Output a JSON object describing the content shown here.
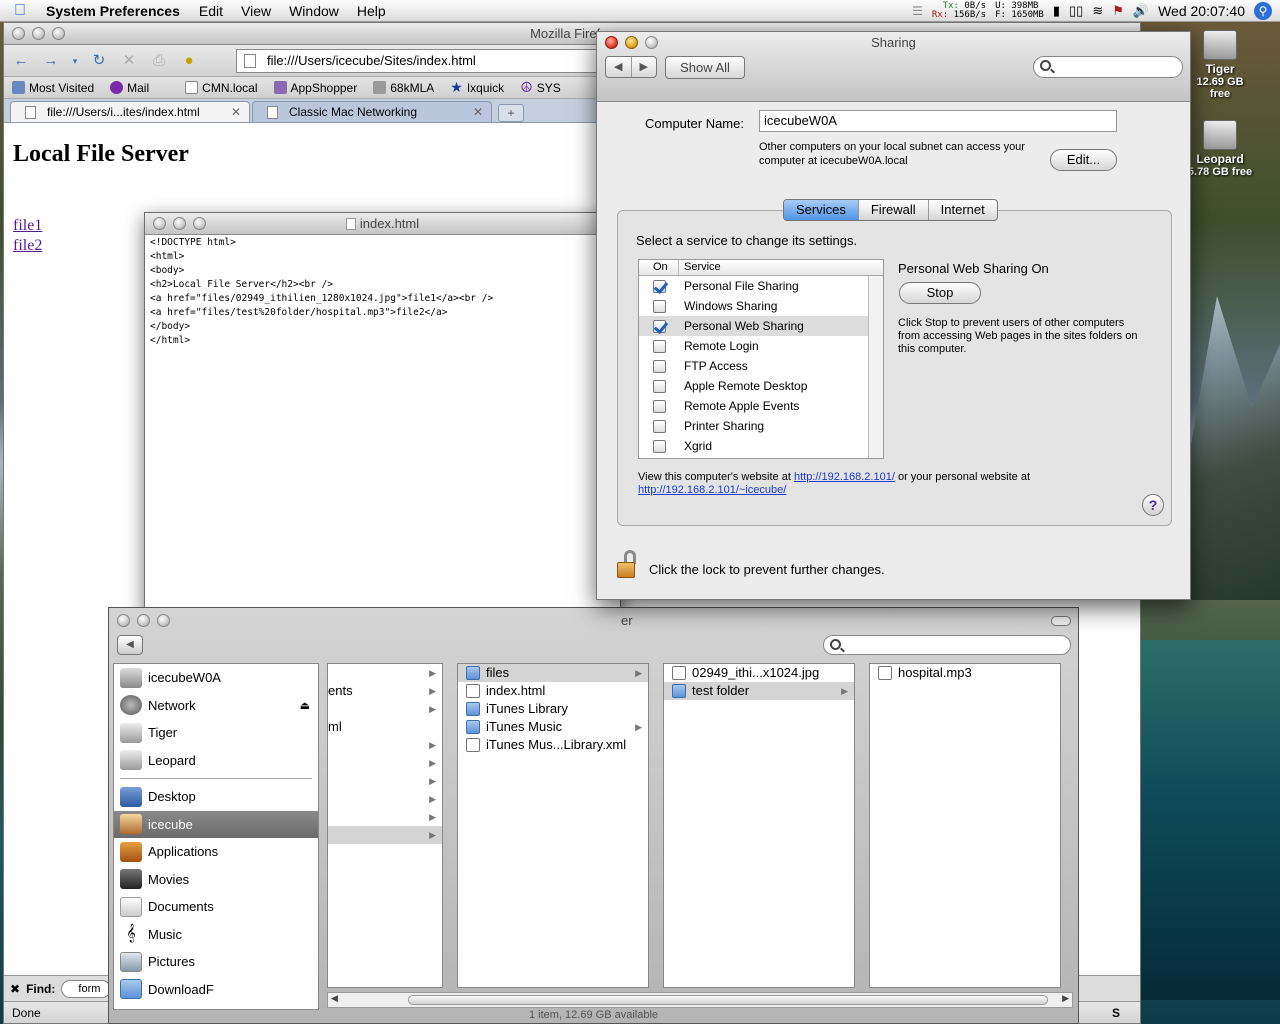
{
  "menubar": {
    "app_name": "System Preferences",
    "menus": [
      "Edit",
      "View",
      "Window",
      "Help"
    ],
    "net_tx_label": "Tx:",
    "net_rx_label": "Rx:",
    "net_tx": "0B/s",
    "net_rx": "156B/s",
    "mem_u": "U: 398MB",
    "mem_f": "F: 1650MB",
    "clock": "Wed 20:07:40"
  },
  "desktop": {
    "disks": [
      {
        "name": "Tiger",
        "free": "12.69 GB free"
      },
      {
        "name": "Leopard",
        "free": "5.78 GB free"
      }
    ]
  },
  "firefox": {
    "title": "Mozilla Firefox",
    "url": "file:///Users/icecube/Sites/index.html",
    "bookmarks": [
      "Most Visited",
      "Mail",
      "CMN.local",
      "AppShopper",
      "68kMLA",
      "Ixquick",
      "SYS"
    ],
    "tabs": [
      {
        "label": "file:///Users/i...ites/index.html",
        "active": true
      },
      {
        "label": "Classic Mac Networking",
        "active": false
      }
    ],
    "page": {
      "heading": "Local File Server",
      "links": [
        "file1",
        "file2"
      ]
    },
    "find_label": "Find:",
    "find_value": "form",
    "status": "Done"
  },
  "source_window": {
    "title": "index.html",
    "lines": [
      "<!DOCTYPE html>",
      "<html>",
      "<body>",
      "",
      "<h2>Local File Server</h2><br />",
      "<a href=\"files/02949_ithilien_1280x1024.jpg\">file1</a><br />",
      "<a href=\"files/test%20folder/hospital.mp3\">file2</a>",
      "</body>",
      "</html>"
    ]
  },
  "sharing": {
    "title": "Sharing",
    "show_all": "Show All",
    "computer_name_label": "Computer Name:",
    "computer_name": "icecubeW0A",
    "computer_note": "Other computers on your local subnet can access your computer at icecubeW0A.local",
    "edit_button": "Edit...",
    "tabs": [
      "Services",
      "Firewall",
      "Internet"
    ],
    "active_tab": "Services",
    "select_prompt": "Select a service to change its settings.",
    "col_on": "On",
    "col_service": "Service",
    "services": [
      {
        "name": "Personal File Sharing",
        "on": true
      },
      {
        "name": "Windows Sharing",
        "on": false
      },
      {
        "name": "Personal Web Sharing",
        "on": true,
        "selected": true
      },
      {
        "name": "Remote Login",
        "on": false
      },
      {
        "name": "FTP Access",
        "on": false
      },
      {
        "name": "Apple Remote Desktop",
        "on": false
      },
      {
        "name": "Remote Apple Events",
        "on": false
      },
      {
        "name": "Printer Sharing",
        "on": false
      },
      {
        "name": "Xgrid",
        "on": false
      }
    ],
    "status_title": "Personal Web Sharing On",
    "stop_button": "Stop",
    "status_desc": "Click Stop to prevent users of other computers from accessing Web pages in the sites folders on this computer.",
    "url_note_pre": "View this computer's website at ",
    "url_link1": "http://192.168.2.101/",
    "url_note_mid": " or your personal website at ",
    "url_link2": "http://192.168.2.101/~icecube/",
    "help": "?",
    "lock_text": "Click the lock to prevent further changes."
  },
  "finder": {
    "title_fragment": "er",
    "sidebar_devices": [
      "icecubeW0A",
      "Network",
      "Tiger",
      "Leopard"
    ],
    "sidebar_places": [
      "Desktop",
      "icecube",
      "Applications",
      "Movies",
      "Documents",
      "Music",
      "Pictures",
      "DownloadF"
    ],
    "sidebar_selected": "icecube",
    "col1_fragments": [
      "ents",
      "ml"
    ],
    "col2": [
      {
        "name": "files",
        "folder": true,
        "arrow": true,
        "selected": true
      },
      {
        "name": "index.html",
        "folder": false
      },
      {
        "name": "iTunes Library",
        "folder": true
      },
      {
        "name": "iTunes Music",
        "folder": true,
        "arrow": true
      },
      {
        "name": "iTunes Mus...Library.xml",
        "folder": false
      }
    ],
    "col3": [
      {
        "name": "02949_ithi...x1024.jpg",
        "folder": false
      },
      {
        "name": "test folder",
        "folder": true,
        "arrow": true,
        "selected": true
      }
    ],
    "col4": [
      {
        "name": "hospital.mp3",
        "folder": false
      }
    ],
    "status": "1 item, 12.69 GB available"
  }
}
